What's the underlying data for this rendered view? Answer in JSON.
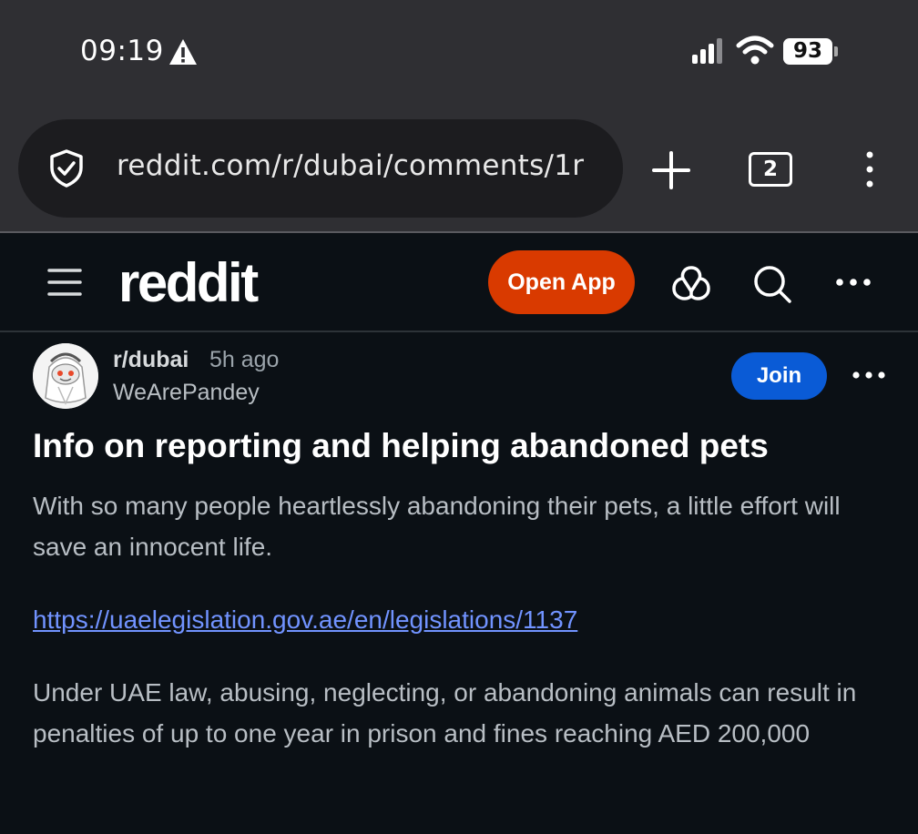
{
  "status_bar": {
    "time": "09:19",
    "battery": "93",
    "icons": [
      "warning-icon",
      "signal-icon",
      "wifi-icon",
      "battery-icon"
    ]
  },
  "browser": {
    "url": "reddit.com/r/dubai/comments/1r",
    "tab_count": "2",
    "icons": [
      "shield-icon",
      "plus-icon",
      "kebab-menu-icon"
    ]
  },
  "reddit_header": {
    "logo": "reddit",
    "open_app_label": "Open App",
    "icons": [
      "hamburger-icon",
      "popular-icon",
      "search-icon",
      "more-icon"
    ],
    "accent_color": "#d93a00"
  },
  "post": {
    "subreddit": "r/dubai",
    "time_ago": "5h ago",
    "author": "WeArePandey",
    "join_label": "Join",
    "join_color": "#0a5bd6",
    "title": "Info on reporting and helping abandoned pets",
    "paragraph1": "With so many people heartlessly abandoning their pets, a little effort will save an innocent life.",
    "link": "https://uaelegislation.gov.ae/en/legislations/1137",
    "link_color": "#7193ff",
    "paragraph2": "Under UAE law, abusing, neglecting, or abandoning animals can result in penalties of up to one year in prison and fines reaching AED 200,000"
  }
}
